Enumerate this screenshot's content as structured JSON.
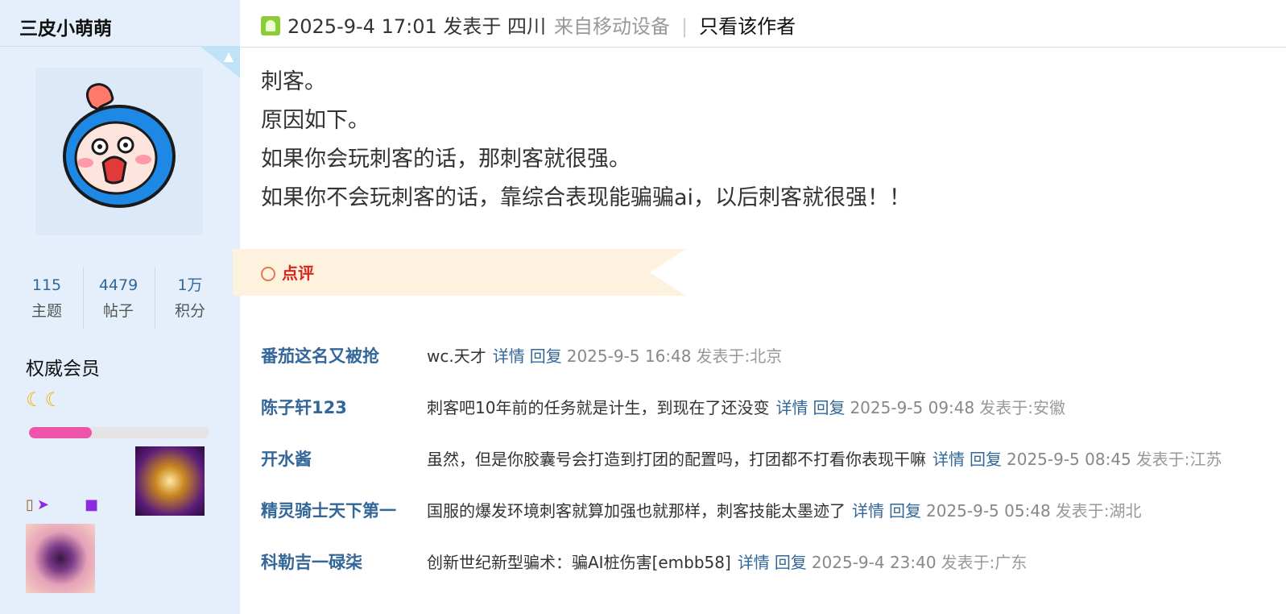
{
  "sidebar": {
    "username": "三皮小萌萌",
    "stats": [
      {
        "value": "115",
        "label": "主题"
      },
      {
        "value": "4479",
        "label": "帖子"
      },
      {
        "value": "1万",
        "label": "积分"
      }
    ],
    "member_level": "权威会员",
    "level_progress": 0.35,
    "colors": {
      "background": "#e5effb",
      "progress_fill": "#ee55aa"
    }
  },
  "header": {
    "datetime": "2025-9-4 17:01 发表于 四川",
    "device": "来自移动设备",
    "separator": "|",
    "only_author": "只看该作者"
  },
  "post": {
    "lines": [
      "刺客。",
      "原因如下。",
      "如果你会玩刺客的话，那刺客就很强。",
      "如果你不会玩刺客的话，靠综合表现能骗骗ai，以后刺客就很强！！"
    ]
  },
  "comments_section": {
    "title": "点评",
    "items": [
      {
        "author": "番茄这名又被抢",
        "text": "wc.天才",
        "detail": "详情",
        "reply": "回复",
        "time": "2025-9-5 16:48",
        "location": "发表于:北京"
      },
      {
        "author": "陈子轩123",
        "text": "刺客吧10年前的任务就是计生，到现在了还没变",
        "detail": "详情",
        "reply": "回复",
        "time": "2025-9-5 09:48",
        "location": "发表于:安徽"
      },
      {
        "author": "开水酱",
        "text": "虽然，但是你胶囊号会打造到打团的配置吗，打团都不打看你表现干嘛",
        "detail": "详情",
        "reply": "回复",
        "time": "2025-9-5 08:45",
        "location": "发表于:江苏"
      },
      {
        "author": "精灵骑士天下第一",
        "text": "国服的爆发环境刺客就算加强也就那样，刺客技能太墨迹了",
        "detail": "详情",
        "reply": "回复",
        "time": "2025-9-5 05:48",
        "location": "发表于:湖北"
      },
      {
        "author": "科勒吉一碌柒",
        "text": "创新世纪新型骗术：骗AI桩伤害[embb58]",
        "detail": "详情",
        "reply": "回复",
        "time": "2025-9-4 23:40",
        "location": "发表于:广东"
      }
    ]
  },
  "icons": [
    "android-icon",
    "online-status-icon",
    "moon-icon",
    "medal-icon"
  ]
}
